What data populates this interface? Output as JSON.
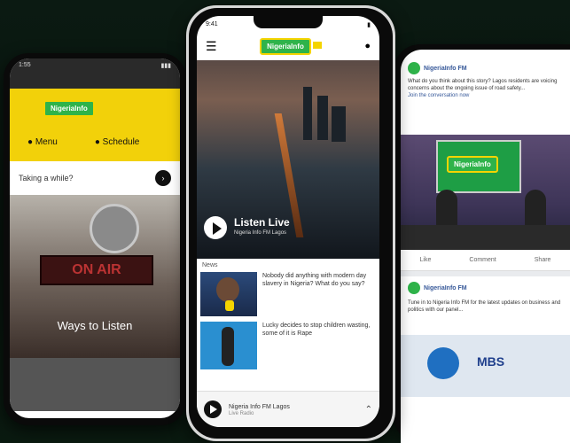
{
  "left": {
    "status_time": "1:55",
    "nav_menu": "Menu",
    "nav_schedule": "Schedule",
    "search_placeholder": "Taking a while?",
    "onair": "ON AIR",
    "hero_caption": "Ways to Listen",
    "logo_text": "NigeriaInfo"
  },
  "center": {
    "status_time": "9:41",
    "logo_text": "NigeriaInfo",
    "listen_title": "Listen Live",
    "listen_sub": "Nigeria Info FM Lagos",
    "section_label": "News",
    "news": [
      {
        "text": "Nobody did anything with modern day slavery in Nigeria? What do you say?"
      },
      {
        "text": "Lucky decides to stop children wasting, some of it is Rape"
      }
    ],
    "player_title": "Nigeria Info FM Lagos",
    "player_sub": "Live Radio"
  },
  "right": {
    "page_name": "NigeriaInfo FM",
    "post_text": "What do you think about this story? Lagos residents are voicing concerns about the ongoing issue of road safety...",
    "post_text2": "Join the conversation now",
    "like": "Like",
    "comment": "Comment",
    "share": "Share",
    "post2_text": "Tune in to Nigeria Info FM for the latest updates on business and politics with our panel...",
    "mbs": "MBS",
    "logo_text": "NigeriaInfo"
  },
  "colors": {
    "brand_green": "#2fb34a",
    "brand_yellow": "#f4d400",
    "fb_blue": "#365899"
  }
}
